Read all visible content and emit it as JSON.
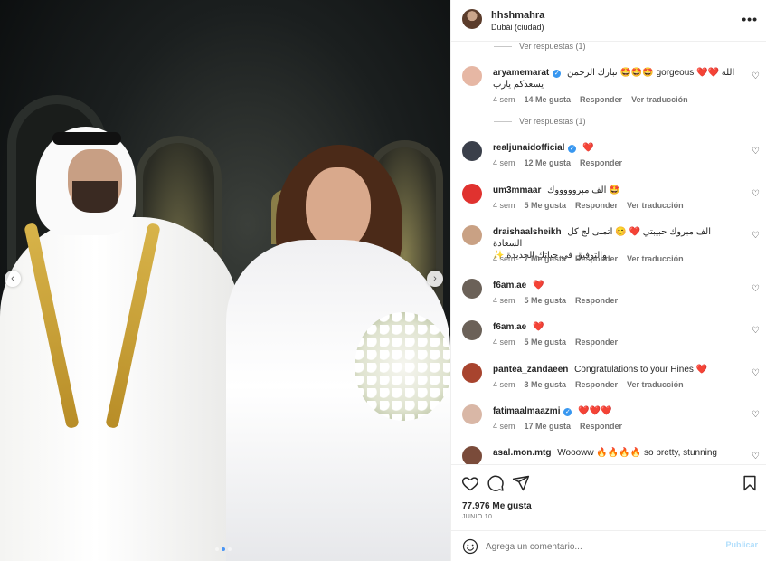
{
  "post": {
    "username": "hhshmahra",
    "location": "Dubái (ciudad)"
  },
  "replies": [
    {
      "label": "Ver respuestas (1)"
    },
    {
      "label": "Ver respuestas (1)"
    }
  ],
  "comments": [
    {
      "user": "aryamemarat",
      "verified": true,
      "text": "تبارك الرحمن 🤩🤩🤩 gorgeous ❤️❤️ الله",
      "text2": "يسعدكم يارب",
      "time": "4 sem",
      "likes": "14 Me gusta",
      "reply": "Responder",
      "translate": "Ver traducción",
      "avatar_color": "#e6b7a4"
    },
    {
      "user": "realjunaidofficial",
      "verified": true,
      "text": "❤️",
      "time": "4 sem",
      "likes": "12 Me gusta",
      "reply": "Responder",
      "translate": "",
      "avatar_color": "#3a3f4a"
    },
    {
      "user": "um3mmaar",
      "verified": false,
      "text": "الف مبروووووك 🤩",
      "time": "4 sem",
      "likes": "5 Me gusta",
      "reply": "Responder",
      "translate": "Ver traducción",
      "avatar_color": "#e0322f"
    },
    {
      "user": "draishaalsheikh",
      "verified": false,
      "text": "الف مبروك حبيبتي ❤️ 😊 اتمنى لج كل السعادة",
      "text2": "والتوفيق في حياتك الجديدة ✨",
      "time": "4 sem",
      "likes": "7 Me gusta",
      "reply": "Responder",
      "translate": "Ver traducción",
      "avatar_color": "#c9a184"
    },
    {
      "user": "f6am.ae",
      "verified": false,
      "text": "❤️",
      "time": "4 sem",
      "likes": "5 Me gusta",
      "reply": "Responder",
      "translate": "",
      "avatar_color": "#6b6158"
    },
    {
      "user": "f6am.ae",
      "verified": false,
      "text": "❤️",
      "time": "4 sem",
      "likes": "5 Me gusta",
      "reply": "Responder",
      "translate": "",
      "avatar_color": "#6b6158"
    },
    {
      "user": "pantea_zandaeen",
      "verified": false,
      "text": "Congratulations to your Hines ❤️",
      "time": "4 sem",
      "likes": "3 Me gusta",
      "reply": "Responder",
      "translate": "Ver traducción",
      "avatar_color": "#a8442e"
    },
    {
      "user": "fatimaalmaazmi",
      "verified": true,
      "text": "❤️❤️❤️",
      "time": "4 sem",
      "likes": "17 Me gusta",
      "reply": "Responder",
      "translate": "",
      "avatar_color": "#d9b7a6"
    },
    {
      "user": "asal.mon.mtg",
      "verified": false,
      "text": "Woooww 🔥🔥🔥🔥 so pretty, stunning",
      "time": "",
      "likes": "",
      "reply": "",
      "translate": "",
      "avatar_color": "#7a4b3a"
    }
  ],
  "actions": {
    "likes": "77.976 Me gusta",
    "date": "JUNIO 10"
  },
  "add_comment": {
    "placeholder": "Agrega un comentario...",
    "publish_label": "Publicar"
  },
  "carousel": {
    "prev": "‹",
    "next": "›",
    "slide_count": 3,
    "active_slide": 1
  }
}
